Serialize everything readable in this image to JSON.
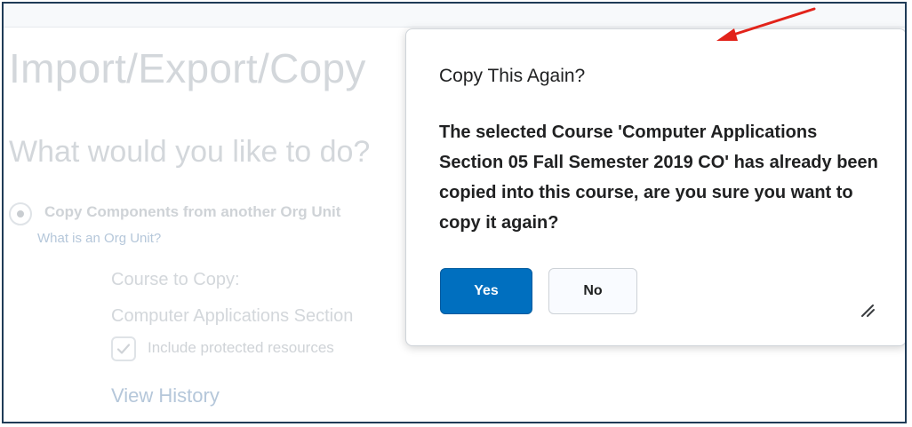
{
  "background_page": {
    "title": "Import/Export/Copy",
    "section_title": "What would you like to do?",
    "option_label": "Copy Components from another Org Unit",
    "org_unit_link": "What is an Org Unit?",
    "course_to_copy_label": "Course to Copy:",
    "course_to_copy_value": "Computer Applications Section",
    "include_protected_label": "Include protected resources",
    "view_history_link": "View History"
  },
  "dialog": {
    "title": "Copy This Again?",
    "message": "The selected Course 'Computer Applications Section 05 Fall Semester 2019 CO' has already been copied into this course, are you sure you want to copy it again?",
    "yes_label": "Yes",
    "no_label": "No"
  },
  "colors": {
    "primary_button": "#006fbf",
    "annotation_arrow": "#e2231a"
  },
  "icons": {
    "radio": "radio-selected-icon",
    "checkbox": "checkmark-icon",
    "resize": "resize-handle-icon",
    "annotation": "red-arrow-icon"
  }
}
